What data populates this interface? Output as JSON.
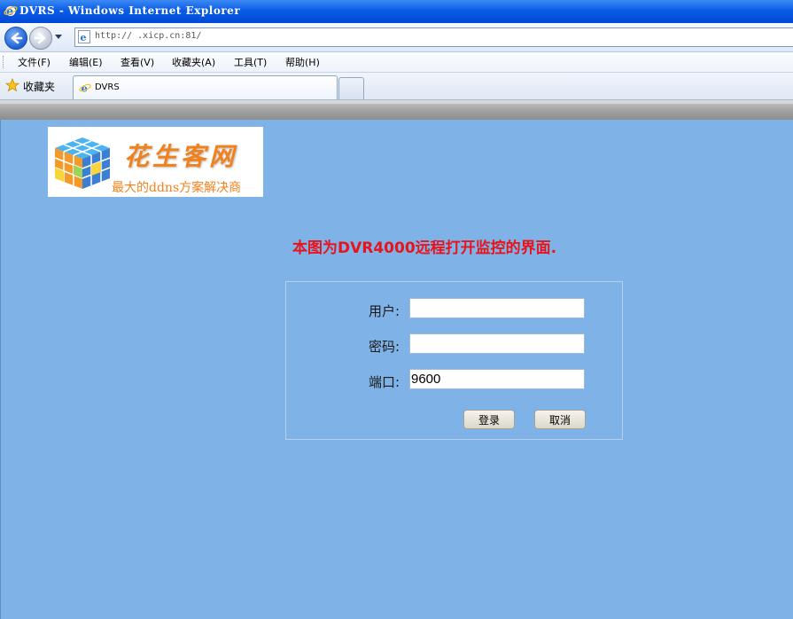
{
  "window": {
    "title": "DVRS - Windows Internet Explorer",
    "app_icon": "ie-icon"
  },
  "navbar": {
    "back_icon": "back-arrow-icon",
    "forward_icon": "forward-arrow-icon",
    "url": "http://    .xicp.cn:81/"
  },
  "menu": {
    "items": [
      "文件(F)",
      "编辑(E)",
      "查看(V)",
      "收藏夹(A)",
      "工具(T)",
      "帮助(H)"
    ]
  },
  "favorites": {
    "label": "收藏夹",
    "icon": "star-icon"
  },
  "tab": {
    "label": "DVRS"
  },
  "logo": {
    "name": "花生客网",
    "tagline": "最大的ddns方案解决商"
  },
  "headline": "本图为DVR4000远程打开监控的界面.",
  "login": {
    "user_label": "用户:",
    "user_value": "",
    "password_label": "密码:",
    "password_value": "",
    "port_label": "端口:",
    "port_value": "9600",
    "login_button": "登录",
    "cancel_button": "取消"
  },
  "colors": {
    "content_bg": "#7fb2e6",
    "headline": "#e8141b",
    "logo_orange": "#f0821e"
  }
}
